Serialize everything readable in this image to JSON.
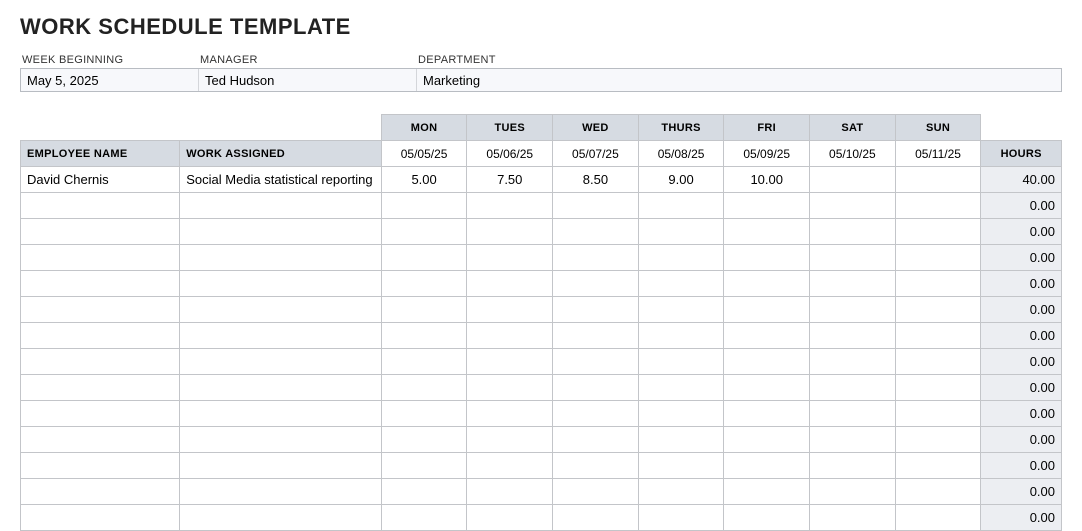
{
  "title": "WORK SCHEDULE TEMPLATE",
  "info": {
    "labels": {
      "week": "WEEK BEGINNING",
      "manager": "MANAGER",
      "department": "DEPARTMENT"
    },
    "values": {
      "week": "May 5, 2025",
      "manager": "Ted Hudson",
      "department": "Marketing"
    }
  },
  "headers": {
    "employee": "EMPLOYEE NAME",
    "work": "WORK ASSIGNED",
    "hours": "HOURS",
    "days": [
      "MON",
      "TUES",
      "WED",
      "THURS",
      "FRI",
      "SAT",
      "SUN"
    ],
    "dates": [
      "05/05/25",
      "05/06/25",
      "05/07/25",
      "05/08/25",
      "05/09/25",
      "05/10/25",
      "05/11/25"
    ]
  },
  "rows": [
    {
      "employee": "David Chernis",
      "work": "Social Media statistical reporting",
      "days": [
        "5.00",
        "7.50",
        "8.50",
        "9.00",
        "10.00",
        "",
        ""
      ],
      "hours": "40.00"
    },
    {
      "employee": "",
      "work": "",
      "days": [
        "",
        "",
        "",
        "",
        "",
        "",
        ""
      ],
      "hours": "0.00"
    },
    {
      "employee": "",
      "work": "",
      "days": [
        "",
        "",
        "",
        "",
        "",
        "",
        ""
      ],
      "hours": "0.00"
    },
    {
      "employee": "",
      "work": "",
      "days": [
        "",
        "",
        "",
        "",
        "",
        "",
        ""
      ],
      "hours": "0.00"
    },
    {
      "employee": "",
      "work": "",
      "days": [
        "",
        "",
        "",
        "",
        "",
        "",
        ""
      ],
      "hours": "0.00"
    },
    {
      "employee": "",
      "work": "",
      "days": [
        "",
        "",
        "",
        "",
        "",
        "",
        ""
      ],
      "hours": "0.00"
    },
    {
      "employee": "",
      "work": "",
      "days": [
        "",
        "",
        "",
        "",
        "",
        "",
        ""
      ],
      "hours": "0.00"
    },
    {
      "employee": "",
      "work": "",
      "days": [
        "",
        "",
        "",
        "",
        "",
        "",
        ""
      ],
      "hours": "0.00"
    },
    {
      "employee": "",
      "work": "",
      "days": [
        "",
        "",
        "",
        "",
        "",
        "",
        ""
      ],
      "hours": "0.00"
    },
    {
      "employee": "",
      "work": "",
      "days": [
        "",
        "",
        "",
        "",
        "",
        "",
        ""
      ],
      "hours": "0.00"
    },
    {
      "employee": "",
      "work": "",
      "days": [
        "",
        "",
        "",
        "",
        "",
        "",
        ""
      ],
      "hours": "0.00"
    },
    {
      "employee": "",
      "work": "",
      "days": [
        "",
        "",
        "",
        "",
        "",
        "",
        ""
      ],
      "hours": "0.00"
    },
    {
      "employee": "",
      "work": "",
      "days": [
        "",
        "",
        "",
        "",
        "",
        "",
        ""
      ],
      "hours": "0.00"
    },
    {
      "employee": "",
      "work": "",
      "days": [
        "",
        "",
        "",
        "",
        "",
        "",
        ""
      ],
      "hours": "0.00"
    }
  ]
}
